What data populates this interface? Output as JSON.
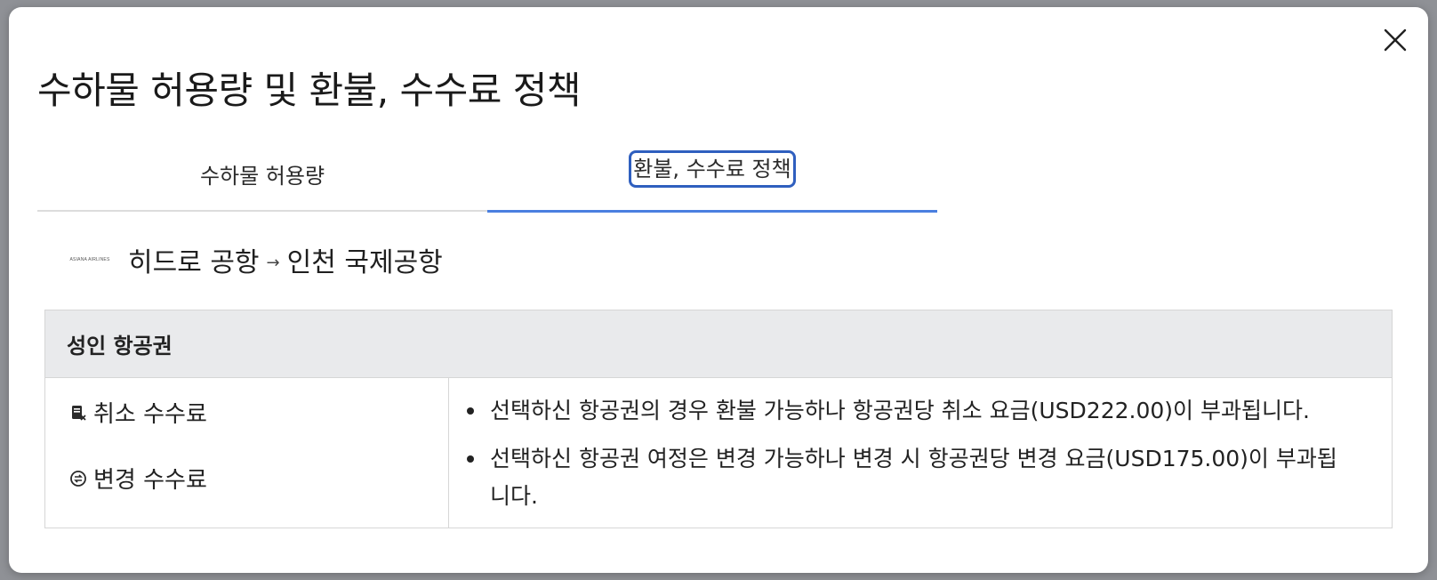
{
  "modal": {
    "title": "수하물 허용량 및 환불, 수수료 정책",
    "close_icon": "close-icon"
  },
  "tabs": [
    {
      "label": "수하물 허용량",
      "active": false
    },
    {
      "label": "환불, 수수료 정책",
      "active": true
    }
  ],
  "route": {
    "airline_logo_text": "ASIANA AIRLINES",
    "origin": "히드로 공항",
    "arrow": "→",
    "destination": "인천 국제공항"
  },
  "fee_table": {
    "header": "성인 항공권",
    "fee_types": [
      {
        "label": "취소 수수료",
        "icon": "cancel-fee-icon"
      },
      {
        "label": "변경 수수료",
        "icon": "change-fee-icon"
      }
    ],
    "notes": [
      "선택하신 항공권의 경우 환불 가능하나 항공권당 취소 요금(USD222.00)이 부과됩니다.",
      "선택하신 항공권 여정은 변경 가능하나 변경 시 항공권당 변경 요금(USD175.00)이 부과됩니다."
    ]
  },
  "colors": {
    "tab_active_underline": "#4a7fe0",
    "focus_outline": "#2f5fbf",
    "table_header_bg": "#e9eaec"
  }
}
